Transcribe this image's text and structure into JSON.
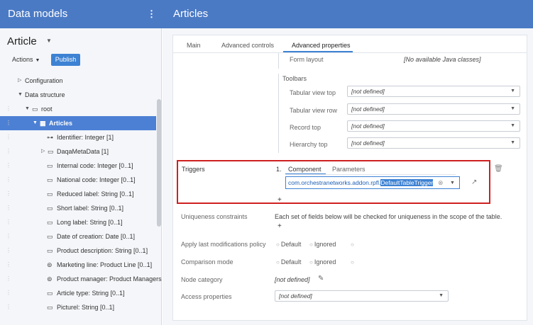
{
  "header": {
    "left_title": "Data models",
    "kebab": "⋮",
    "right_title": "Articles"
  },
  "sidebar": {
    "model_name": "Article",
    "actions_label": "Actions",
    "publish_label": "Publish",
    "tree": [
      {
        "label": "Configuration",
        "icon": "chevron-right-icon"
      },
      {
        "label": "Data structure",
        "icon": "chevron-down-icon"
      },
      {
        "label": "root",
        "icon": "folder-icon"
      },
      {
        "label": "Articles",
        "icon": "table-icon",
        "selected": true
      },
      {
        "label": "Identifier: Integer  [1]",
        "icon": "key-icon"
      },
      {
        "label": "DaqaMetaData [1]",
        "icon": "folder-icon"
      },
      {
        "label": "Internal code: Integer  [0..1]",
        "icon": "field-icon"
      },
      {
        "label": "National code: Integer  [0..1]",
        "icon": "field-icon"
      },
      {
        "label": "Reduced label: String  [0..1]",
        "icon": "field-icon"
      },
      {
        "label": "Short label: String  [0..1]",
        "icon": "field-icon"
      },
      {
        "label": "Long label: String  [0..1]",
        "icon": "field-icon"
      },
      {
        "label": "Date of creation: Date  [0..1]",
        "icon": "field-icon"
      },
      {
        "label": "Product description: String  [0..1]",
        "icon": "field-icon"
      },
      {
        "label": "Marketing line: Product Line  [0..1]",
        "icon": "link-icon"
      },
      {
        "label": "Product manager: Product Managers",
        "icon": "link-icon"
      },
      {
        "label": "Article type: String  [0..1]",
        "icon": "field-icon"
      },
      {
        "label": "Picturel: String  [0..1]",
        "icon": "field-icon"
      }
    ]
  },
  "tabs": {
    "main": "Main",
    "advanced_controls": "Advanced controls",
    "advanced_properties": "Advanced properties"
  },
  "form": {
    "form_layout_label": "Form layout",
    "form_layout_value": "[No available Java classes]",
    "toolbars_heading": "Toolbars",
    "toolbars": [
      {
        "label": "Tabular view top",
        "value": "[not defined]"
      },
      {
        "label": "Tabular view row",
        "value": "[not defined]"
      },
      {
        "label": "Record top",
        "value": "[not defined]"
      },
      {
        "label": "Hierarchy top",
        "value": "[not defined]"
      }
    ],
    "triggers_label": "Triggers",
    "trigger_index": "1.",
    "trigger_tab_component": "Component",
    "trigger_tab_parameters": "Parameters",
    "trigger_value_prefix": "com.orchestranetworks.addon.rpfl.",
    "trigger_value_selected": "DefaultTableTrigger",
    "add_symbol": "+",
    "uniqueness_label": "Uniqueness constraints",
    "uniqueness_text": "Each set of fields below will be checked for uniqueness in the scope of the table.",
    "apply_last_label": "Apply last modifications policy",
    "comparison_label": "Comparison mode",
    "radio_default": "Default",
    "radio_ignored": "Ignored",
    "node_category_label": "Node category",
    "node_category_value": "[not defined]",
    "access_label": "Access properties",
    "access_value": "[not defined]"
  }
}
